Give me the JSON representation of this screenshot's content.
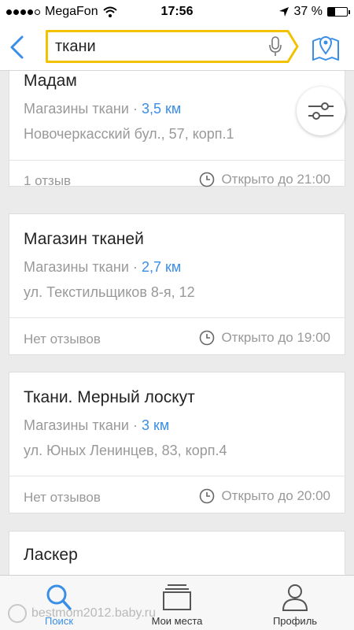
{
  "status_bar": {
    "carrier": "MegaFon",
    "time": "17:56",
    "battery": "37 %",
    "battery_level": 0.37
  },
  "search": {
    "query": "ткани"
  },
  "results": [
    {
      "name": "Мадам",
      "category": "Магазины ткани",
      "separator": "·",
      "distance": "3,5 км",
      "address": "Новочеркасский бул., 57, корп.1",
      "reviews": "1 отзыв",
      "hours": "Открыто до 21:00"
    },
    {
      "name": "Магазин тканей",
      "category": "Магазины ткани",
      "separator": "·",
      "distance": "2,7 км",
      "address": "ул. Текстильщиков 8-я, 12",
      "reviews": "Нет отзывов",
      "hours": "Открыто до 19:00"
    },
    {
      "name": "Ткани. Мерный лоскут",
      "category": "Магазины ткани",
      "separator": "·",
      "distance": "3 км",
      "address": "ул. Юных Ленинцев, 83, корп.4",
      "reviews": "Нет отзывов",
      "hours": "Открыто до 20:00"
    },
    {
      "name": "Ласкер"
    }
  ],
  "tabs": [
    {
      "label": "Поиск",
      "icon": "search-icon",
      "active": true
    },
    {
      "label": "Мои места",
      "icon": "places-icon",
      "active": false
    },
    {
      "label": "Профиль",
      "icon": "profile-icon",
      "active": false
    }
  ],
  "watermark": "bestmom2012.baby.ru",
  "colors": {
    "accent": "#3a8ee6",
    "search_border": "#f2c200",
    "background": "#ebebeb"
  }
}
